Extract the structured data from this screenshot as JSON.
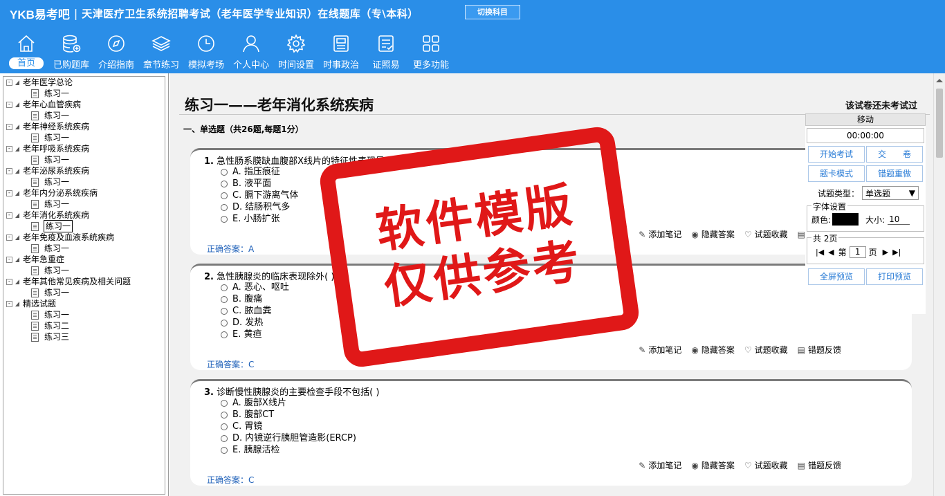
{
  "header": {
    "brand": "YKB易考吧",
    "title": "天津医疗卫生系统招聘考试（老年医学专业知识）在线题库（专\\本科）",
    "switch_label": "切换科目"
  },
  "nav": [
    {
      "label": "首页",
      "icon": "home-icon"
    },
    {
      "label": "已购题库",
      "icon": "database-icon"
    },
    {
      "label": "介绍指南",
      "icon": "compass-icon"
    },
    {
      "label": "章节练习",
      "icon": "layers-icon"
    },
    {
      "label": "模拟考场",
      "icon": "clock-icon"
    },
    {
      "label": "个人中心",
      "icon": "user-icon"
    },
    {
      "label": "时间设置",
      "icon": "gear-icon"
    },
    {
      "label": "时事政治",
      "icon": "news-icon"
    },
    {
      "label": "证照易",
      "icon": "checklist-icon"
    },
    {
      "label": "更多功能",
      "icon": "grid-icon"
    }
  ],
  "tree": [
    {
      "label": "老年医学总论",
      "children": [
        "练习一"
      ]
    },
    {
      "label": "老年心血管疾病",
      "children": [
        "练习一"
      ]
    },
    {
      "label": "老年神经系统疾病",
      "children": [
        "练习一"
      ]
    },
    {
      "label": "老年呼吸系统疾病",
      "children": [
        "练习一"
      ]
    },
    {
      "label": "老年泌尿系统疾病",
      "children": [
        "练习一"
      ]
    },
    {
      "label": "老年内分泌系统疾病",
      "children": [
        "练习一"
      ]
    },
    {
      "label": "老年消化系统疾病",
      "children": [
        "练习一"
      ]
    },
    {
      "label": "老年免疫及血液系统疾病",
      "children": [
        "练习一"
      ]
    },
    {
      "label": "老年急重症",
      "children": [
        "练习一"
      ]
    },
    {
      "label": "老年其他常见疾病及相关问题",
      "children": [
        "练习一"
      ]
    },
    {
      "label": "精选试题",
      "children": [
        "练习一",
        "练习二",
        "练习三"
      ]
    }
  ],
  "paper": {
    "title": "练习一——老年消化系统疾病",
    "status": "该试卷还未考试过",
    "section": "一、单选题（共26题,每题1分）"
  },
  "questions": [
    {
      "num": "1.",
      "stem": "急性肠系膜缺血腹部X线片的特征性表现是(  )",
      "options": [
        "A. 指压痕征",
        "B. 液平面",
        "C. 膈下游离气体",
        "D. 结肠积气多",
        "E. 小肠扩张"
      ],
      "answer_label": "正确答案：",
      "answer": "A"
    },
    {
      "num": "2.",
      "stem": "急性胰腺炎的临床表现除外(  )",
      "options": [
        "A. 恶心、呕吐",
        "B. 腹痛",
        "C. 脓血粪",
        "D. 发热",
        "E. 黄疸"
      ],
      "answer_label": "正确答案：",
      "answer": "C"
    },
    {
      "num": "3.",
      "stem": "诊断慢性胰腺炎的主要检查手段不包括(  )",
      "options": [
        "A. 腹部X线片",
        "B. 腹部CT",
        "C. 胃镜",
        "D. 内镜逆行胰胆管造影(ERCP)",
        "E. 胰腺活检"
      ],
      "answer_label": "正确答案：",
      "answer": "C"
    }
  ],
  "actions": [
    {
      "label": "添加笔记",
      "icon": "pencil-icon"
    },
    {
      "label": "隐藏答案",
      "icon": "eye-icon"
    },
    {
      "label": "试题收藏",
      "icon": "heart-icon"
    },
    {
      "label": "错题反馈",
      "icon": "feedback-icon"
    }
  ],
  "side": {
    "move_label": "移动",
    "timer": "00:00:00",
    "start_exam": "开始考试",
    "submit": "交　　卷",
    "card_mode": "题卡模式",
    "redo_wrong": "错题重做",
    "type_label": "试题类型：",
    "type_value": "单选题",
    "font_legend": "字体设置",
    "color_label": "颜色:",
    "color_value": "#000000",
    "size_label": "大小:",
    "size_value": "10",
    "pages_legend": "共 2页",
    "page_prefix": "第",
    "page_value": "1",
    "page_suffix": "页",
    "fullscreen": "全屏预览",
    "print": "打印预览"
  },
  "watermark": {
    "line1": "软件模版",
    "line2": "仅供参考"
  }
}
